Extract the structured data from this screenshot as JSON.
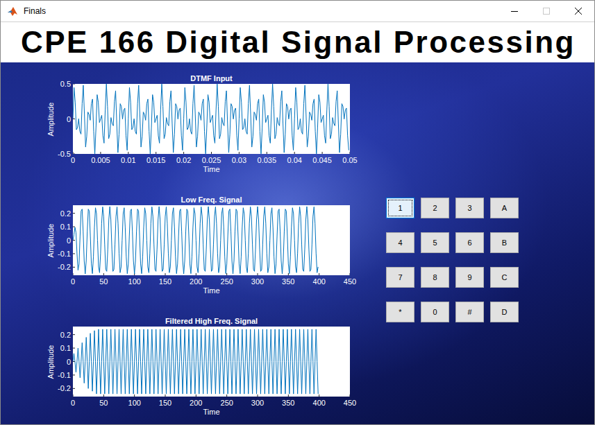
{
  "window": {
    "title": "Finals",
    "maximize_disabled": true
  },
  "banner": {
    "title": "CPE 166 Digital Signal Processing"
  },
  "plots": [
    {
      "title": "DTMF Input",
      "x_label": "Time",
      "y_label": "Amplitude",
      "x_ticks": [
        "0",
        "0.005",
        "0.01",
        "0.015",
        "0.02",
        "0.025",
        "0.03",
        "0.035",
        "0.04",
        "0.045",
        "0.05"
      ],
      "y_ticks": [
        "0.5",
        "0",
        "-0.5"
      ],
      "x_range": [
        0,
        0.05
      ],
      "y_range": [
        -0.5,
        0.5
      ],
      "x_step": 0.000208333,
      "series": [
        {
          "values": [
            0,
            0.448,
            0.241,
            -0.154,
            -0.125,
            0.002,
            -0.177,
            -0.217,
            0.217,
            0.481,
            0.065,
            -0.402,
            -0.25,
            0.098,
            0.065,
            -0.019,
            0.217,
            0.283,
            -0.177,
            -0.498,
            -0.125,
            0.346,
            0.241,
            -0.052,
            0,
            0.052,
            -0.241,
            -0.346,
            0.125,
            0.498,
            0.177,
            -0.283,
            -0.217,
            0.019,
            -0.065,
            -0.098,
            0.25,
            0.402,
            -0.065,
            -0.481,
            -0.217,
            0.217,
            0.177,
            -0.002,
            0.125,
            0.154,
            -0.241,
            -0.448,
            0,
            0.448,
            0.241,
            -0.154,
            -0.125,
            0.002,
            -0.177,
            -0.217,
            0.217,
            0.481,
            0.065,
            -0.402,
            -0.25,
            0.098,
            0.065,
            -0.019,
            0.217,
            0.283,
            -0.177,
            -0.498,
            -0.125,
            0.346,
            0.241,
            -0.052,
            0,
            0.052,
            -0.241,
            -0.346,
            0.125,
            0.498,
            0.177,
            -0.283,
            -0.217,
            0.019,
            -0.065,
            -0.098,
            0.25,
            0.402,
            -0.065,
            -0.481,
            -0.217,
            0.217,
            0.177,
            -0.002,
            0.125,
            0.154,
            -0.241,
            -0.448,
            0,
            0.448,
            0.241,
            -0.154,
            -0.125,
            0.002,
            -0.177,
            -0.217,
            0.217,
            0.481,
            0.065,
            -0.402,
            -0.25,
            0.098,
            0.065,
            -0.019,
            0.217,
            0.283,
            -0.177,
            -0.498,
            -0.125,
            0.346,
            0.241,
            -0.052,
            0,
            0.052,
            -0.241,
            -0.346,
            0.125,
            0.498,
            0.177,
            -0.283,
            -0.217,
            0.019,
            -0.065,
            -0.098,
            0.25,
            0.402,
            -0.065,
            -0.481,
            -0.217,
            0.217,
            0.177,
            -0.002,
            0.125,
            0.154,
            -0.241,
            -0.448,
            0,
            0.448,
            0.241,
            -0.154,
            -0.125,
            0.002,
            -0.177,
            -0.217,
            0.217,
            0.481,
            0.065,
            -0.402,
            -0.25,
            0.098,
            0.065,
            -0.019,
            0.217,
            0.283,
            -0.177,
            -0.498,
            -0.125,
            0.346,
            0.241,
            -0.052,
            0,
            0.052,
            -0.241,
            -0.346,
            0.125,
            0.498,
            0.177,
            -0.283,
            -0.217,
            0.019,
            -0.065,
            -0.098,
            0.25,
            0.402,
            -0.065,
            -0.481,
            -0.217,
            0.217,
            0.177,
            -0.002,
            0.125,
            0.154,
            -0.241,
            -0.448,
            0,
            0.448,
            0.241,
            -0.154,
            -0.125,
            0.002,
            -0.177,
            -0.217,
            0.217,
            0.481,
            0.065,
            -0.402,
            -0.25,
            0.098,
            0.065,
            -0.019,
            0.217,
            0.283,
            -0.177,
            -0.498,
            -0.125,
            0.346,
            0.241,
            -0.052,
            0,
            0.052,
            -0.241,
            -0.346,
            0.125,
            0.498,
            0.177,
            -0.283,
            -0.217,
            0.019,
            -0.065,
            -0.098,
            0.25,
            0.402,
            -0.065,
            -0.481,
            -0.217,
            0.217,
            0.177,
            -0.002,
            0.125,
            0.154,
            -0.241,
            -0.448
          ]
        }
      ]
    },
    {
      "title": "Low Freq. Signal",
      "x_label": "Time",
      "y_label": "Amplitude",
      "x_ticks": [
        "0",
        "50",
        "100",
        "150",
        "200",
        "250",
        "300",
        "350",
        "400",
        "450"
      ],
      "y_ticks": [
        "0.2",
        "0.1",
        "0",
        "-0.1",
        "-0.2"
      ],
      "x_range": [
        0,
        450
      ],
      "y_range": [
        -0.26,
        0.26
      ],
      "x_step": 1.6667,
      "series": [
        {
          "values": [
            0,
            0.04,
            0.096,
            0.058,
            -0.1,
            -0.223,
            -0.177,
            0.033,
            0.217,
            0.231,
            0.065,
            -0.152,
            -0.25,
            -0.152,
            0.065,
            0.231,
            0.217,
            0.033,
            -0.177,
            -0.248,
            -0.125,
            0.096,
            0.241,
            0.198,
            0,
            -0.198,
            -0.241,
            -0.096,
            0.125,
            0.248,
            0.177,
            -0.033,
            -0.217,
            -0.231,
            -0.065,
            0.152,
            0.25,
            0.152,
            -0.065,
            -0.231,
            -0.217,
            -0.033,
            0.177,
            0.248,
            0.125,
            -0.096,
            -0.241,
            -0.198,
            0,
            0.198,
            0.241,
            0.096,
            -0.125,
            -0.248,
            -0.177,
            0.033,
            0.217,
            0.231,
            0.065,
            -0.152,
            -0.25,
            -0.152,
            0.065,
            0.231,
            0.217,
            0.033,
            -0.177,
            -0.248,
            -0.125,
            0.096,
            0.241,
            0.198,
            0,
            -0.198,
            -0.241,
            -0.096,
            0.125,
            0.248,
            0.177,
            -0.033,
            -0.217,
            -0.231,
            -0.065,
            0.152,
            0.25,
            0.152,
            -0.065,
            -0.231,
            -0.217,
            -0.033,
            0.177,
            0.248,
            0.125,
            -0.096,
            -0.241,
            -0.198,
            0,
            0.198,
            0.241,
            0.096,
            -0.125,
            -0.248,
            -0.177,
            0.033,
            0.217,
            0.231,
            0.065,
            -0.152,
            -0.25,
            -0.152,
            0.065,
            0.231,
            0.217,
            0.033,
            -0.177,
            -0.248,
            -0.125,
            0.096,
            0.241,
            0.198,
            0,
            -0.198,
            -0.241,
            -0.096,
            0.125,
            0.248,
            0.177,
            -0.033,
            -0.217,
            -0.231,
            -0.065,
            0.152,
            0.25,
            0.152,
            -0.065,
            -0.231,
            -0.217,
            -0.033,
            0.177,
            0.248,
            0.125,
            -0.096,
            -0.241,
            -0.198,
            0,
            0.198,
            0.241,
            0.096,
            -0.125,
            -0.248,
            -0.177,
            0.033,
            0.217,
            0.231,
            0.065,
            -0.152,
            -0.25,
            -0.152,
            0.065,
            0.231,
            0.217,
            0.033,
            -0.177,
            -0.248,
            -0.125,
            0.096,
            0.241,
            0.198,
            0,
            -0.198,
            -0.241,
            -0.096,
            0.125,
            0.248,
            0.177,
            -0.033,
            -0.217,
            -0.231,
            -0.065,
            0.152,
            0.25,
            0.152,
            -0.065,
            -0.231,
            -0.217,
            -0.033,
            0.177,
            0.248,
            0.125,
            -0.096,
            -0.241,
            -0.198,
            0,
            0.198,
            0.241,
            0.096,
            -0.125,
            -0.248,
            -0.177,
            0.033,
            0.217,
            0.231,
            0.065,
            -0.152,
            -0.25,
            -0.152,
            0.065,
            0.231,
            0.217,
            0.033,
            -0.177,
            -0.248,
            -0.125,
            0.096,
            0.241,
            0.198,
            0,
            -0.198,
            -0.241,
            -0.096,
            0.125,
            0.248,
            0.177,
            -0.033,
            -0.217,
            -0.231,
            -0.065,
            0.152,
            0.25,
            0.152,
            -0.065,
            -0.231,
            -0.217,
            -0.033,
            0.177,
            0.248,
            0.125,
            -0.096,
            -0.241,
            -0.198
          ]
        }
      ]
    },
    {
      "title": "Filtered High Freq. Signal",
      "x_label": "Time",
      "y_label": "Amplitude",
      "x_ticks": [
        "0",
        "50",
        "100",
        "150",
        "200",
        "250",
        "300",
        "350",
        "400",
        "450"
      ],
      "y_ticks": [
        "0.2",
        "0.1",
        "0",
        "-0.1",
        "-0.2"
      ],
      "x_range": [
        0,
        450
      ],
      "y_range": [
        -0.26,
        0.26
      ],
      "x_step": 1.6667,
      "series": [
        {
          "values": [
            0,
            0.06,
            0,
            -0.08,
            0,
            0.1,
            0,
            -0.12,
            0,
            0.14,
            0,
            -0.16,
            0,
            0.18,
            0,
            -0.2,
            0,
            0.21,
            0,
            -0.22,
            0,
            0.23,
            0,
            -0.24,
            0,
            0.24,
            0,
            -0.24,
            0,
            0.24,
            0,
            -0.24,
            0,
            0.24,
            0,
            -0.24,
            0,
            0.24,
            0,
            -0.24,
            0,
            0.24,
            0,
            -0.24,
            0,
            0.24,
            0,
            -0.24,
            0,
            0.24,
            0,
            -0.24,
            0,
            0.24,
            0,
            -0.24,
            0,
            0.24,
            0,
            -0.24,
            0,
            0.24,
            0,
            -0.24,
            0,
            0.24,
            0,
            -0.24,
            0,
            0.24,
            0,
            -0.24,
            0,
            0.24,
            0,
            -0.24,
            0,
            0.24,
            0,
            -0.24,
            0,
            0.24,
            0,
            -0.24,
            0,
            0.24,
            0,
            -0.24,
            0,
            0.24,
            0,
            -0.24,
            0,
            0.24,
            0,
            -0.24,
            0,
            0.24,
            0,
            -0.24,
            0,
            0.24,
            0,
            -0.24,
            0,
            0.24,
            0,
            -0.24,
            0,
            0.24,
            0,
            -0.24,
            0,
            0.24,
            0,
            -0.24,
            0,
            0.24,
            0,
            -0.24,
            0,
            0.24,
            0,
            -0.24,
            0,
            0.24,
            0,
            -0.24,
            0,
            0.24,
            0,
            -0.24,
            0,
            0.24,
            0,
            -0.24,
            0,
            0.24,
            0,
            -0.24,
            0,
            0.24,
            0,
            -0.24,
            0,
            0.24,
            0,
            -0.24,
            0,
            0.24,
            0,
            -0.24,
            0,
            0.24,
            0,
            -0.24,
            0,
            0.24,
            0,
            -0.24,
            0,
            0.24,
            0,
            -0.24,
            0,
            0.24,
            0,
            -0.24,
            0,
            0.24,
            0,
            -0.24,
            0,
            0.24,
            0,
            -0.24,
            0,
            0.24,
            0,
            -0.24,
            0,
            0.24,
            0,
            -0.24,
            0,
            0.24,
            0,
            -0.24,
            0,
            0.24,
            0,
            -0.24,
            0,
            0.24,
            0,
            -0.24,
            0,
            0.24,
            0,
            -0.24,
            0,
            0.24,
            0,
            -0.24,
            0,
            0.24,
            0,
            -0.24,
            0,
            0.24,
            0,
            -0.24,
            0,
            0.24,
            0,
            -0.24,
            0,
            0.24,
            0,
            -0.24,
            0,
            0.24,
            0,
            -0.24,
            0,
            0.24,
            0,
            -0.24,
            0,
            0.24,
            0,
            -0.24,
            0,
            0.24,
            0,
            -0.24,
            0,
            0.24,
            0,
            -0.24
          ]
        }
      ]
    }
  ],
  "keypad": {
    "keys": [
      {
        "label": "1",
        "selected": true
      },
      {
        "label": "2",
        "selected": false
      },
      {
        "label": "3",
        "selected": false
      },
      {
        "label": "A",
        "selected": false
      },
      {
        "label": "4",
        "selected": false
      },
      {
        "label": "5",
        "selected": false
      },
      {
        "label": "6",
        "selected": false
      },
      {
        "label": "B",
        "selected": false
      },
      {
        "label": "7",
        "selected": false
      },
      {
        "label": "8",
        "selected": false
      },
      {
        "label": "9",
        "selected": false
      },
      {
        "label": "C",
        "selected": false
      },
      {
        "label": "*",
        "selected": false
      },
      {
        "label": "0",
        "selected": false
      },
      {
        "label": "#",
        "selected": false
      },
      {
        "label": "D",
        "selected": false
      }
    ]
  }
}
